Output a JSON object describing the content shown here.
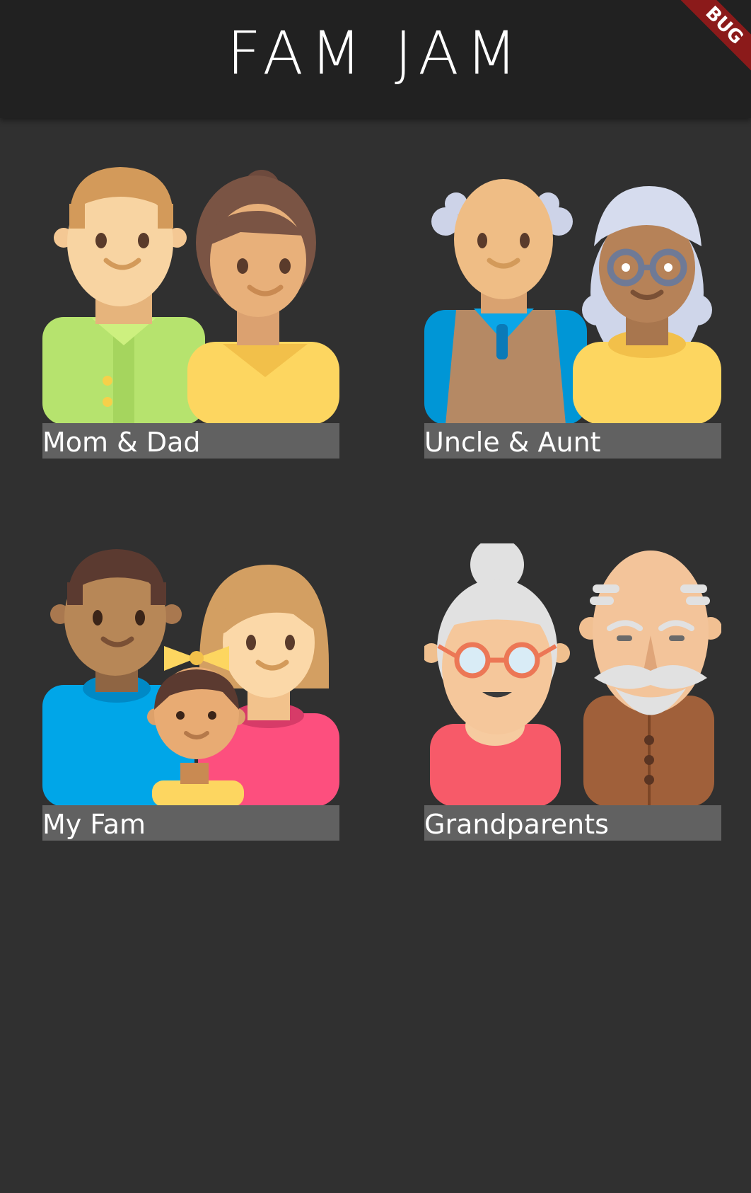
{
  "app_bar": {
    "title": "FAM JAM"
  },
  "debug_banner": "BUG",
  "tiles": [
    {
      "label": "Mom & Dad",
      "image": "mom-dad-illustration"
    },
    {
      "label": "Uncle & Aunt",
      "image": "uncle-aunt-illustration"
    },
    {
      "label": "My Fam",
      "image": "my-fam-illustration"
    },
    {
      "label": "Grandparents",
      "image": "grandparents-illustration"
    }
  ],
  "colors": {
    "background": "#303030",
    "app_bar": "#212121",
    "label_bar": "#616161",
    "text": "#ffffff",
    "debug_banner": "#8b1a1a"
  }
}
